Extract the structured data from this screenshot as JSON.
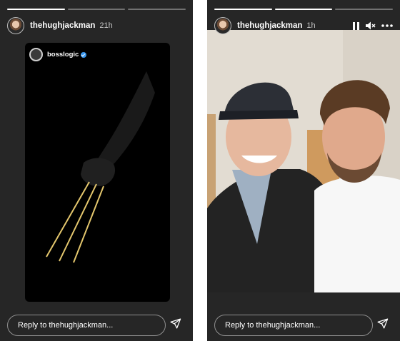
{
  "left_story": {
    "progress": {
      "segments": 3,
      "active": 1
    },
    "username": "thehughjackman",
    "time": "21h",
    "reshared_post": {
      "username": "bosslogic",
      "verified": true
    },
    "reply_placeholder": "Reply to thehughjackman..."
  },
  "right_story": {
    "progress": {
      "segments": 3,
      "active": 2
    },
    "username": "thehughjackman",
    "time": "1h",
    "reply_placeholder": "Reply to thehughjackman..."
  },
  "icons": {
    "pause": "pause-icon",
    "mute": "speaker-muted-icon",
    "more": "more-dots-icon",
    "send": "paper-plane-icon",
    "verified": "verified-badge-icon"
  },
  "colors": {
    "background_dark": "#262626",
    "text": "#ffffff",
    "muted_text": "#c8c8c8",
    "verified_blue": "#3897f0"
  }
}
